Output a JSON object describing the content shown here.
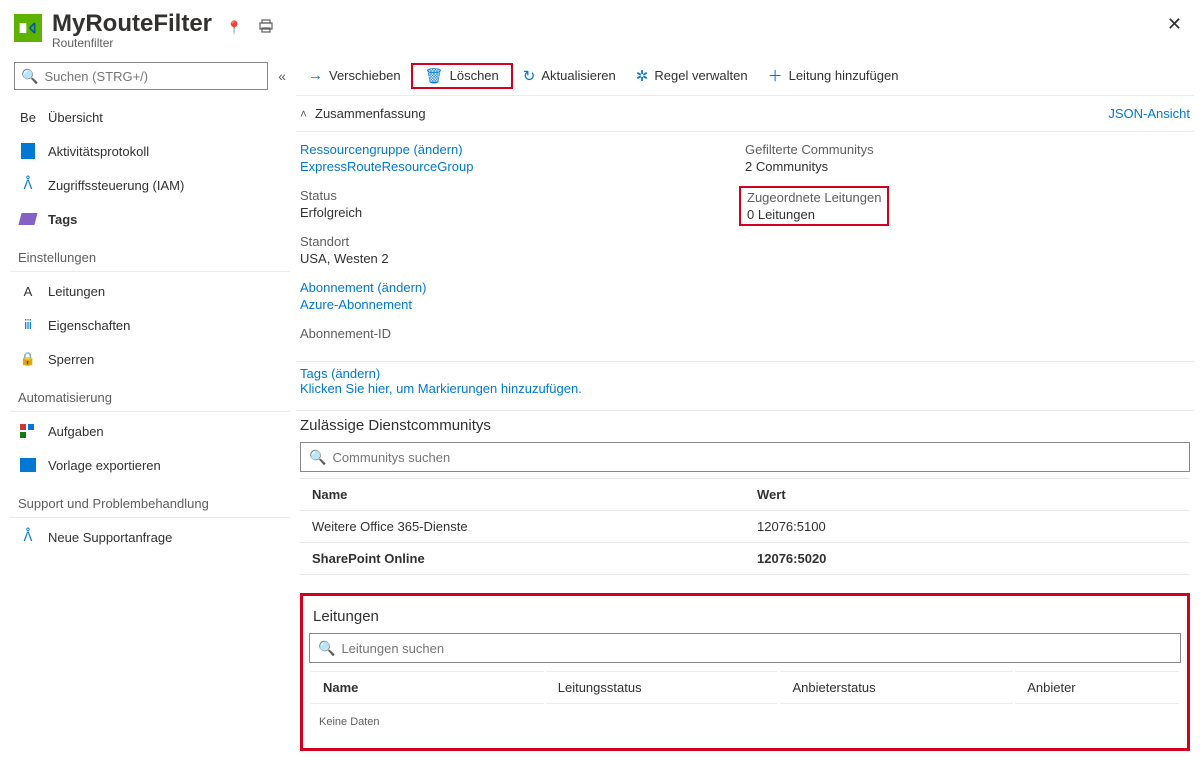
{
  "header": {
    "title": "MyRouteFilter",
    "subtitle": "Routenfilter"
  },
  "sidebar": {
    "search_placeholder": "Suchen (STRG+/)",
    "items": {
      "overview": "Übersicht",
      "activity": "Aktivitätsprotokoll",
      "iam": "Zugriffssteuerung (IAM)",
      "tags": "Tags"
    },
    "sections": {
      "settings": "Einstellungen",
      "settings_items": {
        "circuits": "Leitungen",
        "properties": "Eigenschaften",
        "locks": "Sperren"
      },
      "automation": "Automatisierung",
      "automation_items": {
        "tasks": "Aufgaben",
        "export": "Vorlage exportieren"
      },
      "support": "Support und Problembehandlung",
      "support_items": {
        "new": "Neue Supportanfrage"
      }
    }
  },
  "toolbar": {
    "move": "Verschieben",
    "delete": "Löschen",
    "refresh": "Aktualisieren",
    "manage": "Regel verwalten",
    "add": "Leitung hinzufügen"
  },
  "summary": {
    "label": "Zusammenfassung",
    "json": "JSON-Ansicht",
    "rg_label": "Ressourcengruppe (ändern)",
    "rg_value": "ExpressRouteResourceGroup",
    "status_label": "Status",
    "status_value": "Erfolgreich",
    "loc_label": "Standort",
    "loc_value": "USA, Westen 2",
    "sub_label": "Abonnement (ändern)",
    "sub_value": "Azure-Abonnement",
    "subid_label": "Abonnement-ID",
    "comm_label": "Gefilterte Communitys",
    "comm_value": "2 Communitys",
    "assoc_label": "Zugeordnete Leitungen",
    "assoc_value": "0 Leitungen",
    "tags_label": "Tags (ändern)",
    "tags_value": "Klicken Sie hier, um Markierungen hinzuzufügen."
  },
  "communities": {
    "title": "Zulässige Dienstcommunitys",
    "search_placeholder": "Communitys suchen",
    "col_name": "Name",
    "col_value": "Wert",
    "rows": [
      {
        "name": "Weitere Office 365-Dienste",
        "value": "12076:5100"
      },
      {
        "name": "SharePoint Online",
        "value": "12076:5020"
      }
    ]
  },
  "circuits": {
    "title": "Leitungen",
    "search_placeholder": "Leitungen suchen",
    "col_name": "Name",
    "col_status": "Leitungsstatus",
    "col_provider_status": "Anbieterstatus",
    "col_provider": "Anbieter",
    "no_data": "Keine Daten"
  }
}
